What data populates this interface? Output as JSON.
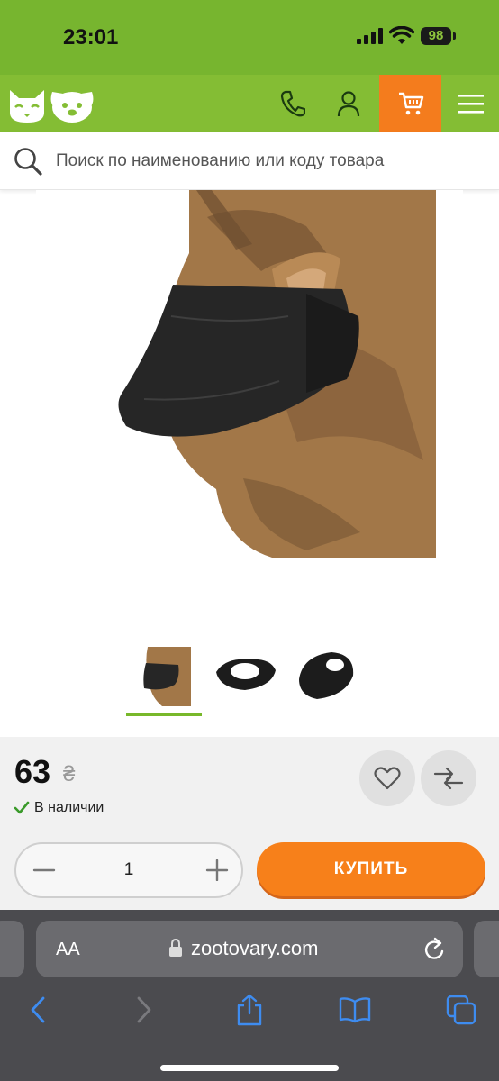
{
  "status_bar": {
    "time": "23:01",
    "battery": "98",
    "icons": [
      "signal-icon",
      "wifi-icon",
      "battery-icon"
    ]
  },
  "header": {
    "logo_icons": [
      "cat-logo-icon",
      "dog-logo-icon"
    ],
    "actions": [
      "phone-icon",
      "user-icon",
      "cart-icon",
      "menu-icon"
    ],
    "colors": {
      "header_bg": "#84bd34",
      "status_bg": "#77b52f",
      "cart_bg": "#f47c1d"
    }
  },
  "search": {
    "placeholder": "Поиск по наименованию или коду товара",
    "icon": "search-icon"
  },
  "product": {
    "thumbnail_count": 3,
    "selected_thumbnail": 1,
    "price": "63",
    "currency": "₴",
    "stock": "В наличии",
    "quantity": "1",
    "buy_label": "КУПИТЬ",
    "accent": "#f7801a",
    "actions": [
      "heart-icon",
      "compare-icon"
    ]
  },
  "browser": {
    "text_size_label": "AA",
    "url": "zootovary.com",
    "toolbar": [
      "back-icon",
      "forward-icon",
      "share-icon",
      "bookmarks-icon",
      "tabs-icon"
    ]
  }
}
